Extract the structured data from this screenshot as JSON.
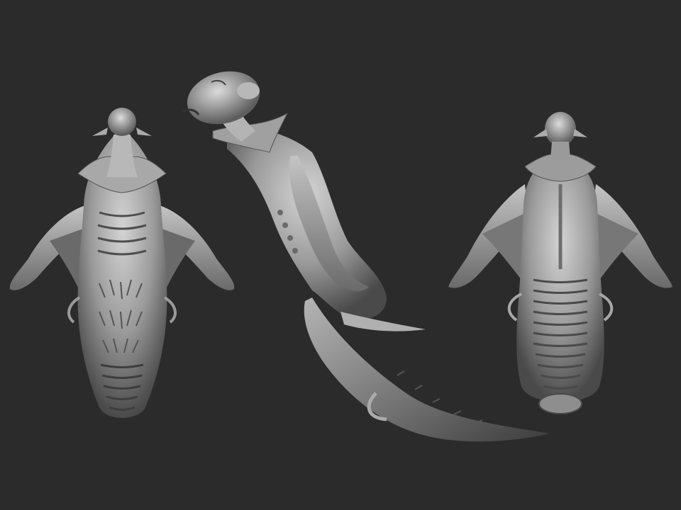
{
  "scene": {
    "background_color": "#2b2b2b",
    "clay_light": "#c9c9c9",
    "clay_mid": "#8e8e8e",
    "clay_dark": "#3a3a3a",
    "views": [
      {
        "view": "front",
        "subject": "creature-sculpt"
      },
      {
        "view": "side",
        "subject": "creature-sculpt"
      },
      {
        "view": "back",
        "subject": "creature-sculpt"
      }
    ]
  }
}
